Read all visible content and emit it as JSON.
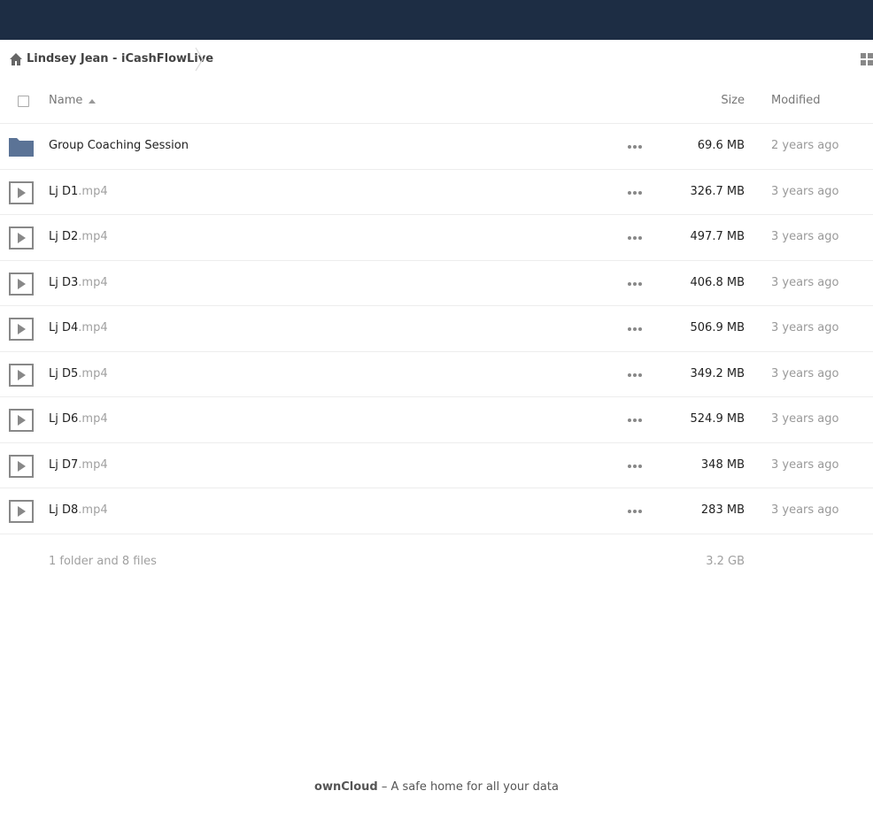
{
  "breadcrumb": {
    "home_icon": "home-icon",
    "current": "Lindsey Jean - iCashFlowLive"
  },
  "view_toggle_icon": "grid-view-icon",
  "columns": {
    "name": "Name",
    "size": "Size",
    "modified": "Modified"
  },
  "files": [
    {
      "name": "Group Coaching Session",
      "ext": "",
      "icon": "folder-icon",
      "size": "69.6 MB",
      "modified": "2 years ago"
    },
    {
      "name": "Lj D1",
      "ext": ".mp4",
      "icon": "video-icon",
      "size": "326.7 MB",
      "modified": "3 years ago"
    },
    {
      "name": "Lj D2",
      "ext": ".mp4",
      "icon": "video-icon",
      "size": "497.7 MB",
      "modified": "3 years ago"
    },
    {
      "name": "Lj D3",
      "ext": ".mp4",
      "icon": "video-icon",
      "size": "406.8 MB",
      "modified": "3 years ago"
    },
    {
      "name": "Lj D4",
      "ext": ".mp4",
      "icon": "video-icon",
      "size": "506.9 MB",
      "modified": "3 years ago"
    },
    {
      "name": "Lj D5",
      "ext": ".mp4",
      "icon": "video-icon",
      "size": "349.2 MB",
      "modified": "3 years ago"
    },
    {
      "name": "Lj D6",
      "ext": ".mp4",
      "icon": "video-icon",
      "size": "524.9 MB",
      "modified": "3 years ago"
    },
    {
      "name": "Lj D7",
      "ext": ".mp4",
      "icon": "video-icon",
      "size": "348 MB",
      "modified": "3 years ago"
    },
    {
      "name": "Lj D8",
      "ext": ".mp4",
      "icon": "video-icon",
      "size": "283 MB",
      "modified": "3 years ago"
    }
  ],
  "summary": {
    "count": "1 folder and 8 files",
    "total_size": "3.2 GB"
  },
  "footer": {
    "brand": "ownCloud",
    "tagline": " – A safe home for all your data"
  },
  "colors": {
    "topbar": "#1d2d44",
    "folder": "#5b7396",
    "muted": "#a0a0a0"
  }
}
